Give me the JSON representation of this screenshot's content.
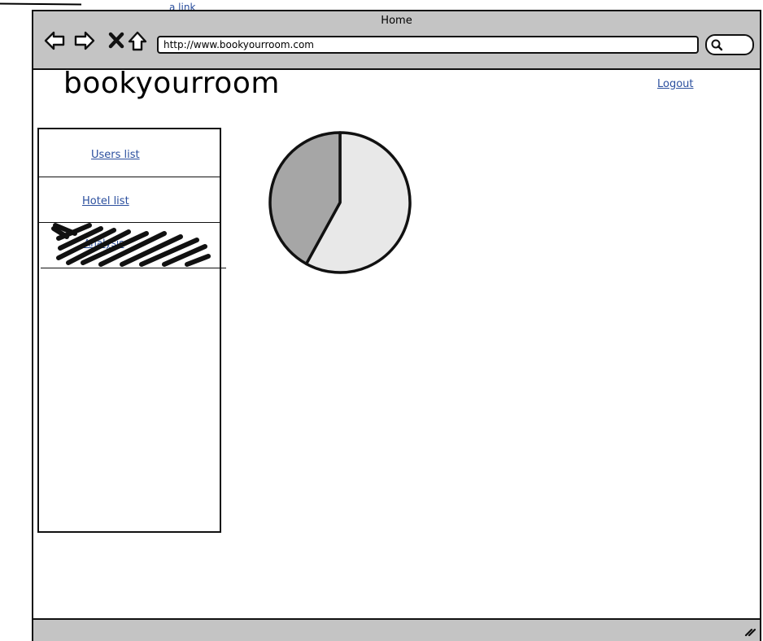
{
  "top_link": "a link",
  "browser": {
    "title": "Home",
    "url": "http://www.bookyourroom.com"
  },
  "header": {
    "brand": "bookyourroom",
    "logout_label": "Logout"
  },
  "sidebar": {
    "items": [
      {
        "label": "Users list"
      },
      {
        "label": "Hotel list"
      },
      {
        "label": "Analysis",
        "scribbled": true
      }
    ]
  },
  "chart_data": {
    "type": "pie",
    "title": "",
    "slices": [
      {
        "value": 58,
        "color": "#e8e8e8"
      },
      {
        "value": 42,
        "color": "#a6a6a6"
      }
    ]
  }
}
